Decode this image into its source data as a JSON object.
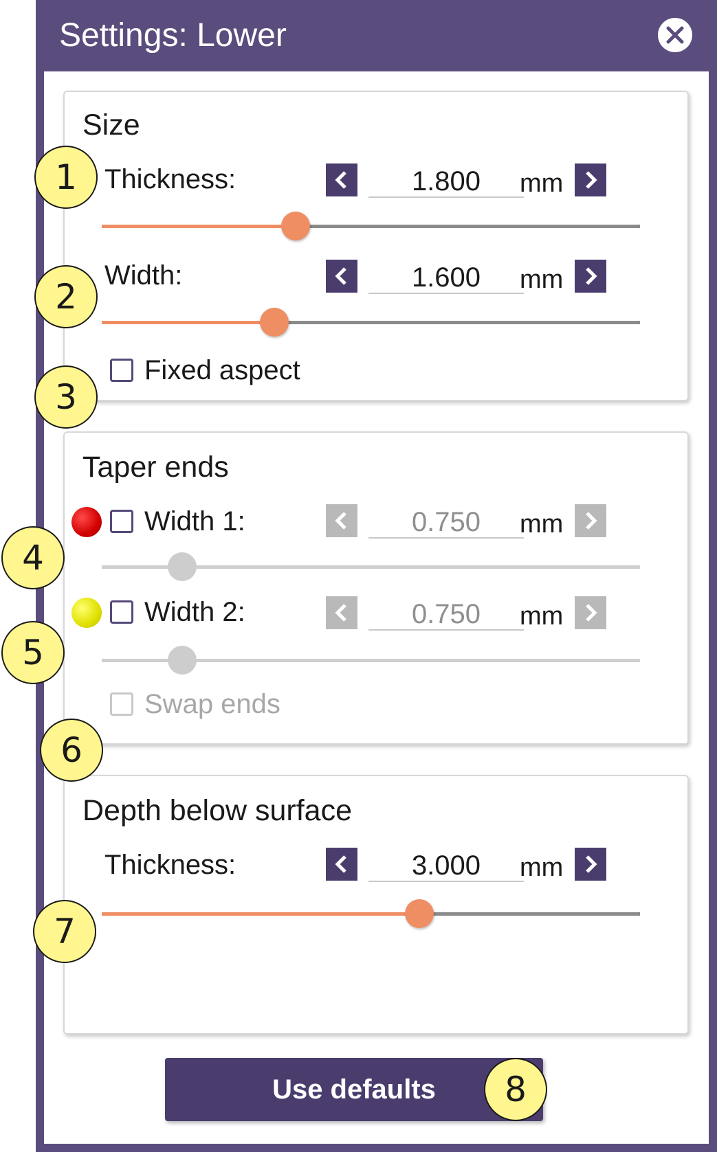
{
  "window": {
    "title": "Settings: Lower"
  },
  "size_group": {
    "title": "Size",
    "thickness": {
      "label": "Thickness:",
      "value": "1.800",
      "unit": "mm",
      "slider_fraction": 0.36
    },
    "width": {
      "label": "Width:",
      "value": "1.600",
      "unit": "mm",
      "slider_fraction": 0.32
    },
    "fixed_aspect": {
      "label": "Fixed aspect",
      "checked": false
    }
  },
  "taper_group": {
    "title": "Taper ends",
    "width1": {
      "label": "Width 1:",
      "value": "0.750",
      "unit": "mm",
      "slider_fraction": 0.15,
      "enabled": false,
      "dot_color": "#e00000"
    },
    "width2": {
      "label": "Width 2:",
      "value": "0.750",
      "unit": "mm",
      "slider_fraction": 0.15,
      "enabled": false,
      "dot_color": "#e6e600"
    },
    "swap_ends": {
      "label": "Swap ends",
      "enabled": false
    }
  },
  "depth_group": {
    "title": "Depth below surface",
    "thickness": {
      "label": "Thickness:",
      "value": "3.000",
      "unit": "mm",
      "slider_fraction": 0.59
    }
  },
  "defaults_button": {
    "label": "Use defaults"
  },
  "callouts": [
    "1",
    "2",
    "3",
    "4",
    "5",
    "6",
    "7",
    "8"
  ],
  "colors": {
    "title_bar": "#5a4d7d",
    "button": "#4a3d6e",
    "slider_accent": "#ef8d63",
    "callout_fill": "#fff68f"
  }
}
